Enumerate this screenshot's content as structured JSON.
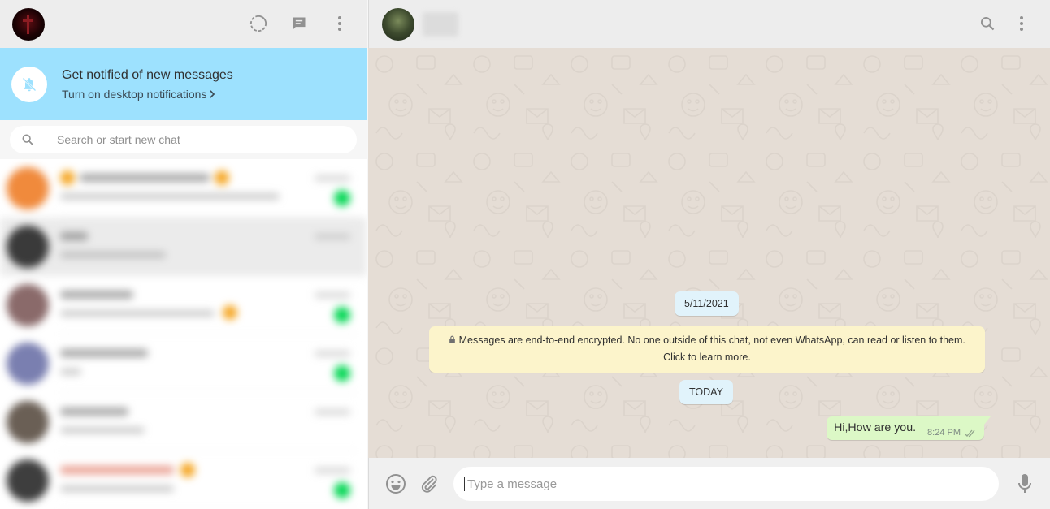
{
  "left_header": {
    "icons": [
      "status-icon",
      "new-chat-icon",
      "menu-icon"
    ]
  },
  "notification": {
    "title": "Get notified of new messages",
    "link": "Turn on desktop notifications"
  },
  "search": {
    "placeholder": "Search or start new chat"
  },
  "conversation": {
    "date_chip": "5/11/2021",
    "encryption_notice_line1": "Messages are end-to-end encrypted. No one outside of this chat, not even WhatsApp, can read or listen to them.",
    "encryption_notice_line2": "Click to learn more.",
    "today_chip": "TODAY",
    "messages": [
      {
        "direction": "outgoing",
        "text": "Hi,How are you.",
        "time": "8:24 PM",
        "status": "delivered"
      }
    ]
  },
  "compose": {
    "placeholder": "Type a message"
  },
  "colors": {
    "notification_bg": "#9de1fe",
    "outgoing_bubble": "#dcf8c6",
    "chat_bg": "#e5ddd5",
    "unread_badge": "#06d755"
  }
}
